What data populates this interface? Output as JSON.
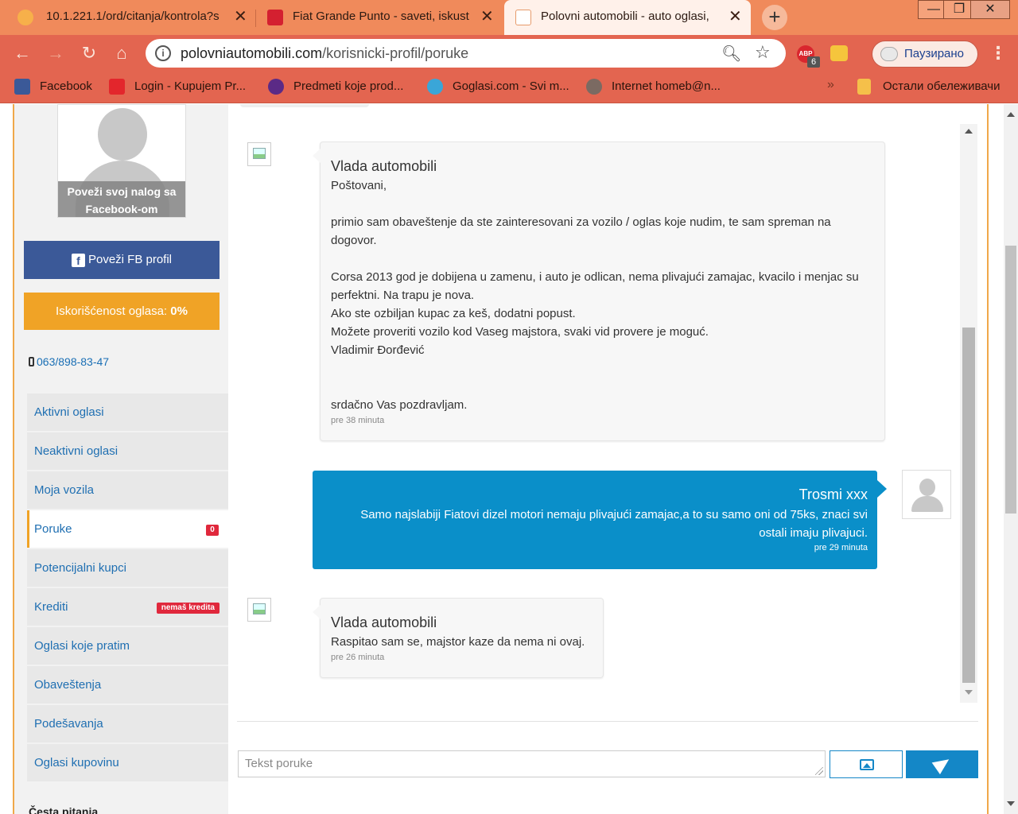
{
  "browser": {
    "tabs": [
      {
        "title": "10.1.221.1/ord/citanja/kontrola?s",
        "active": false
      },
      {
        "title": "Fiat Grande Punto - saveti, iskust",
        "active": false
      },
      {
        "title": "Polovni automobili - auto oglasi,",
        "active": true
      }
    ],
    "close_glyph": "✕",
    "new_tab_glyph": "+",
    "window_controls": {
      "minimize": "—",
      "restore": "❐",
      "close": "✕"
    },
    "url": {
      "host": "polovniautomobili.com",
      "path": "/korisnicki-profil/poruke"
    },
    "extensions": {
      "abp_label": "ABP",
      "abp_count": "6"
    },
    "profile_status": "Паузирано",
    "bookmarks": [
      {
        "label": "Facebook",
        "color": "#3b5998"
      },
      {
        "label": "Login - Kupujem Pr...",
        "color": "#e3262c"
      },
      {
        "label": "Predmeti koje prod...",
        "color": "#5b2a86"
      },
      {
        "label": "Goglasi.com - Svi m...",
        "color": "#3aa6d8"
      },
      {
        "label": "Internet homeb@n...",
        "color": "#7b6a62"
      }
    ],
    "bookmarks_more": "»",
    "other_bookmarks": "Остали обележивачи"
  },
  "sidebar": {
    "avatar_caption": "Poveži svoj nalog sa Facebook-om",
    "fb_button": "Poveži FB profil",
    "usage_label": "Iskorišćenost oglasa:",
    "usage_value": "0%",
    "phone": "063/898-83-47",
    "menu": [
      {
        "label": "Aktivni oglasi"
      },
      {
        "label": "Neaktivni oglasi"
      },
      {
        "label": "Moja vozila"
      },
      {
        "label": "Poruke",
        "badge": "0",
        "active": true
      },
      {
        "label": "Potencijalni kupci"
      },
      {
        "label": "Krediti",
        "badge": "nemaš kredita"
      },
      {
        "label": "Oglasi koje pratim"
      },
      {
        "label": "Obaveštenja"
      },
      {
        "label": "Podešavanja"
      },
      {
        "label": "Oglasi kupovinu"
      }
    ],
    "faq": "Česta pitanja"
  },
  "chat": {
    "messages": [
      {
        "sender": "Vlada automobili",
        "body": "Poštovani,\n\nprimio sam obaveštenje da ste zainteresovani za vozilo / oglas koje nudim, te sam spreman na dogovor.\n\nCorsa 2013 god je dobijena u zamenu, i auto je odlican, nema plivajući zamajac, kvacilo i menjac su perfektni. Na trapu je nova.\nAko ste ozbiljan kupac za keš, dodatni popust.\nMožete proveriti vozilo kod Vaseg majstora, svaki vid provere je moguć.\nVladimir Đorđević\n\n\nsrdačno Vas pozdravljam.",
        "time": "pre 38 minuta",
        "direction": "incoming"
      },
      {
        "sender": "Trosmi xxx",
        "body": "Samo najslabiji Fiatovi dizel motori nemaju plivajući zamajac,a to su samo oni od 75ks, znaci svi ostali imaju plivajuci.",
        "time": "pre 29 minuta",
        "direction": "outgoing"
      },
      {
        "sender": "Vlada automobili",
        "body": "Raspitao sam se, majstor kaze da nema ni ovaj.",
        "time": "pre 26 minuta",
        "direction": "incoming"
      }
    ],
    "input_placeholder": "Tekst poruke"
  },
  "colors": {
    "accent_orange": "#f0a326",
    "link_blue": "#1f6fb2",
    "facebook_blue": "#3b5998",
    "outgoing_bubble": "#0a8fc9",
    "badge_red": "#e0283c",
    "browser_tab": "#f08a5b",
    "browser_toolbar": "#e36550"
  }
}
